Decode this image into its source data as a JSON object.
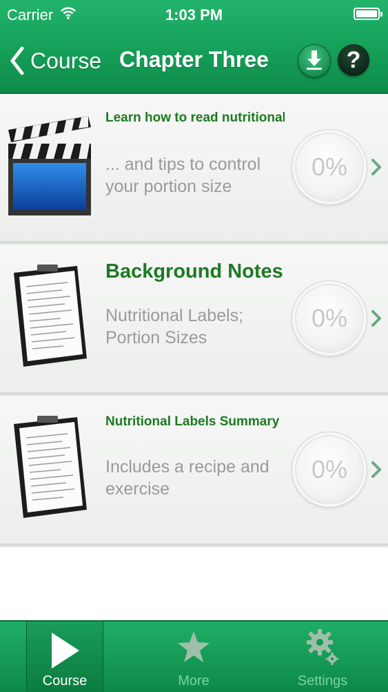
{
  "status_bar": {
    "carrier": "Carrier",
    "time": "1:03 PM"
  },
  "nav": {
    "back_label": "Course",
    "title": "Chapter Three",
    "download_icon": "download-icon",
    "help_label": "?"
  },
  "items": [
    {
      "heading": "Learn how to read nutritional l...",
      "desc_line1": "... and tips to control",
      "desc_line2": "your portion size",
      "progress": "0%",
      "thumbnail_icon": "clapperboard-icon"
    },
    {
      "heading": "Background Notes",
      "desc_line1": "Nutritional Labels;",
      "desc_line2": "Portion Sizes",
      "progress": "0%",
      "thumbnail_icon": "clipboard-notes-icon"
    },
    {
      "heading": "Nutritional Labels Summary",
      "desc_line1": "Includes a recipe and",
      "desc_line2": "exercise",
      "progress": "0%",
      "thumbnail_icon": "clipboard-notes-icon"
    }
  ],
  "tabs": [
    {
      "label": "Course",
      "icon": "play-icon",
      "selected": true
    },
    {
      "label": "More",
      "icon": "star-icon",
      "selected": false
    },
    {
      "label": "Settings",
      "icon": "gear-icon",
      "selected": false
    }
  ],
  "colors": {
    "brand_green": "#17a35b",
    "heading_green": "#1d7a21",
    "muted_text": "#9a9a9a"
  }
}
